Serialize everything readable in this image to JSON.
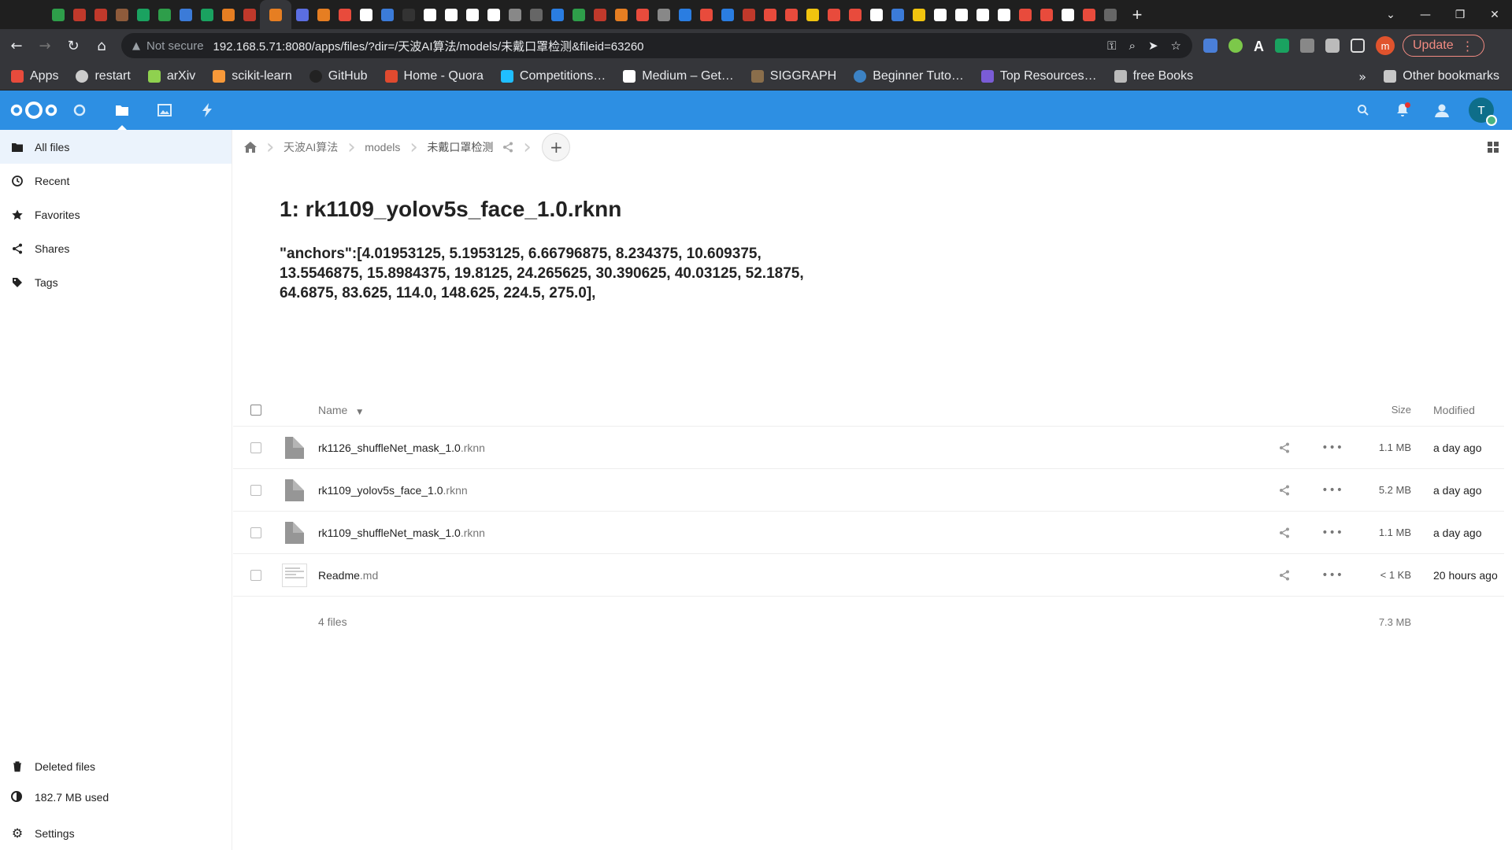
{
  "browser": {
    "tabs_count": 52,
    "address": {
      "security": "Not secure",
      "url": "192.168.5.71:8080/apps/files/?dir=/天波AI算法/models/未戴口罩检测&fileid=63260"
    },
    "update_label": "Update",
    "profile_initial": "m",
    "bookmarks": [
      {
        "label": "Apps",
        "icon": "apps-grid-icon",
        "color": "#e84b3c"
      },
      {
        "label": "restart",
        "icon": "globe-icon",
        "color": "#cccccc"
      },
      {
        "label": "arXiv",
        "icon": "arxiv-icon",
        "color": "#8fd14f"
      },
      {
        "label": "scikit-learn",
        "icon": "sklearn-icon",
        "color": "#f89939"
      },
      {
        "label": "GitHub",
        "icon": "github-icon",
        "color": "#222222"
      },
      {
        "label": "Home - Quora",
        "icon": "quora-icon",
        "color": "#e04a2f"
      },
      {
        "label": "Competitions…",
        "icon": "kaggle-icon",
        "color": "#20beff"
      },
      {
        "label": "Medium – Get…",
        "icon": "medium-icon",
        "color": "#ffffff"
      },
      {
        "label": "SIGGRAPH",
        "icon": "siggraph-icon",
        "color": "#8a6e4b"
      },
      {
        "label": "Beginner Tuto…",
        "icon": "globe-icon",
        "color": "#3c82c4"
      },
      {
        "label": "Top Resources…",
        "icon": "search-icon",
        "color": "#7a5cd6"
      },
      {
        "label": "free Books",
        "icon": "checker-icon",
        "color": "#bbbbbb"
      }
    ],
    "bookmarks_more": "»",
    "other_bookmarks": "Other bookmarks"
  },
  "nextcloud": {
    "apps": [
      "dashboard-icon",
      "files-icon",
      "photos-icon",
      "activity-icon"
    ],
    "user_initial": "T"
  },
  "sidebar": {
    "items": [
      {
        "label": "All files",
        "icon": "folder-icon",
        "active": true
      },
      {
        "label": "Recent",
        "icon": "clock-icon",
        "active": false
      },
      {
        "label": "Favorites",
        "icon": "star-icon",
        "active": false
      },
      {
        "label": "Shares",
        "icon": "share-icon",
        "active": false
      },
      {
        "label": "Tags",
        "icon": "tag-icon",
        "active": false
      }
    ],
    "deleted_files": "Deleted files",
    "quota": "182.7 MB used",
    "settings": "Settings"
  },
  "breadcrumb": [
    "天波AI算法",
    "models",
    "未戴口罩检测"
  ],
  "readme": {
    "heading": "1: rk1109_yolov5s_face_1.0.rknn",
    "body": "\"anchors\":[4.01953125, 5.1953125, 6.66796875, 8.234375, 10.609375, 13.5546875, 15.8984375, 19.8125, 24.265625, 30.390625, 40.03125, 52.1875, 64.6875, 83.625, 114.0, 148.625, 224.5, 275.0],"
  },
  "file_table": {
    "headers": {
      "name": "Name",
      "size": "Size",
      "modified": "Modified"
    },
    "rows": [
      {
        "base": "rk1126_shuffleNet_mask_1.0",
        "ext": ".rknn",
        "size": "1.1 MB",
        "modified": "a day ago",
        "type": "file"
      },
      {
        "base": "rk1109_yolov5s_face_1.0",
        "ext": ".rknn",
        "size": "5.2 MB",
        "modified": "a day ago",
        "type": "file"
      },
      {
        "base": "rk1109_shuffleNet_mask_1.0",
        "ext": ".rknn",
        "size": "1.1 MB",
        "modified": "a day ago",
        "type": "file"
      },
      {
        "base": "Readme",
        "ext": ".md",
        "size": "< 1 KB",
        "modified": "20 hours ago",
        "type": "doc"
      }
    ],
    "footer": {
      "count": "4 files",
      "total_size": "7.3 MB"
    }
  },
  "colors": {
    "nc_primary": "#2d8fe3",
    "chrome_dark": "#35363a"
  }
}
